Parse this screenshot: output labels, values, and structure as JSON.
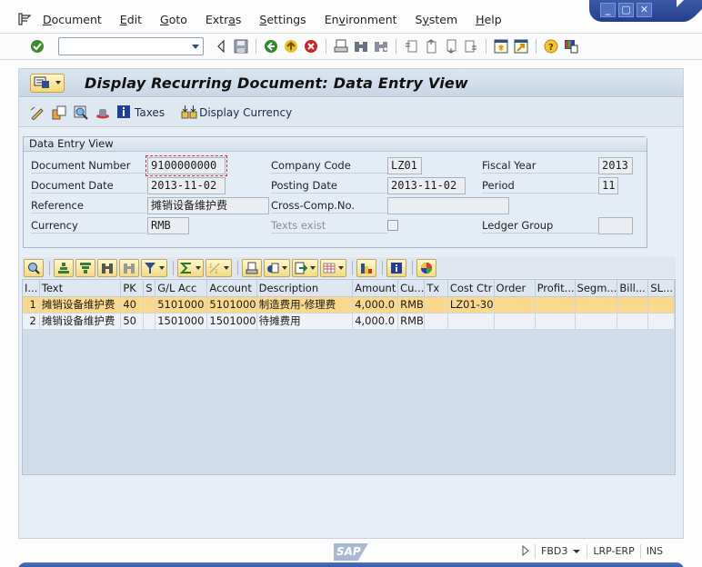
{
  "window": {
    "controls": [
      {
        "name": "minimize",
        "glyph": "_"
      },
      {
        "name": "maximize",
        "glyph": "▢"
      },
      {
        "name": "close",
        "glyph": "✕"
      }
    ]
  },
  "menubar": {
    "items": [
      {
        "label": "Document",
        "mnemonic_index": 0
      },
      {
        "label": "Edit",
        "mnemonic_index": 0
      },
      {
        "label": "Goto",
        "mnemonic_index": 0
      },
      {
        "label": "Extras",
        "mnemonic_index": 4
      },
      {
        "label": "Settings",
        "mnemonic_index": 0
      },
      {
        "label": "Environment",
        "mnemonic_index": 2
      },
      {
        "label": "System",
        "mnemonic_index": 1
      },
      {
        "label": "Help",
        "mnemonic_index": 0
      }
    ]
  },
  "system_toolbar": {
    "command_field": {
      "value": "",
      "placeholder": ""
    },
    "icons": [
      "enter-icon",
      "back-arrow-icon",
      "save-icon",
      "back-icon",
      "exit-icon",
      "cancel-icon",
      "print-icon",
      "find-icon",
      "find-next-icon",
      "first-page-icon",
      "previous-page-icon",
      "next-page-icon",
      "last-page-icon",
      "create-session-icon",
      "create-shortcut-icon",
      "help-icon",
      "customize-layout-icon"
    ]
  },
  "page": {
    "title": "Display Recurring Document: Data Entry View"
  },
  "app_toolbar": {
    "icons": [
      "edit-icon",
      "document-change-icon",
      "display-overview-icon",
      "hat-icon"
    ],
    "taxes_label": "Taxes",
    "display_currency_label": "Display Currency"
  },
  "header": {
    "group_title": "Data Entry View",
    "fields": {
      "document_number": {
        "label": "Document Number",
        "value": "9100000000"
      },
      "company_code": {
        "label": "Company Code",
        "value": "LZ01"
      },
      "fiscal_year": {
        "label": "Fiscal Year",
        "value": "2013"
      },
      "document_date": {
        "label": "Document Date",
        "value": "2013-11-02"
      },
      "posting_date": {
        "label": "Posting Date",
        "value": "2013-11-02"
      },
      "period": {
        "label": "Period",
        "value": "11"
      },
      "reference": {
        "label": "Reference",
        "value": "摊销设备维护费"
      },
      "cross_comp_no": {
        "label": "Cross-Comp.No.",
        "value": ""
      },
      "currency": {
        "label": "Currency",
        "value": "RMB"
      },
      "texts_exist": {
        "label": "Texts exist",
        "checked": false
      },
      "ledger_group": {
        "label": "Ledger Group",
        "value": ""
      }
    }
  },
  "alv": {
    "toolbar": [
      "details-icon",
      "sort-ascending-icon",
      "sort-descending-icon",
      "find-icon",
      "find-next-icon",
      "filter-icon",
      "sum-icon",
      "subtotal-icon",
      "print-preview-icon",
      "views-icon",
      "export-icon",
      "layout-icon",
      "abc-analysis-icon",
      "info-icon",
      "graphic-icon"
    ],
    "columns": [
      "I...",
      "Text",
      "PK",
      "S",
      "G/L Acc",
      "Account",
      "Description",
      "Amount",
      "Cu...",
      "Tx",
      "Cost Ctr",
      "Order",
      "Profit...",
      "Segm...",
      "Bill...",
      "SL..."
    ],
    "rows": [
      {
        "selected": true,
        "cells": [
          "1",
          "摊销设备维护费",
          "40",
          "",
          "5101000",
          "5101000",
          "制造费用-修理费",
          "4,000.0",
          "RMB",
          "",
          "LZ01-30",
          "",
          "",
          "",
          "",
          ""
        ]
      },
      {
        "selected": false,
        "cells": [
          "2",
          "摊销设备维护费",
          "50",
          "",
          "1501000",
          "1501000",
          "待摊费用",
          "4,000.0",
          "RMB",
          "",
          "",
          "",
          "",
          "",
          "",
          ""
        ]
      }
    ]
  },
  "statusbar": {
    "logo": "SAP",
    "transaction": "FBD3",
    "system": "LRP-ERP",
    "mode": "INS"
  },
  "colors": {
    "selected_row": "#fad98c",
    "frame_background": "#e8eef6",
    "window_control": "#2f4d9e"
  }
}
